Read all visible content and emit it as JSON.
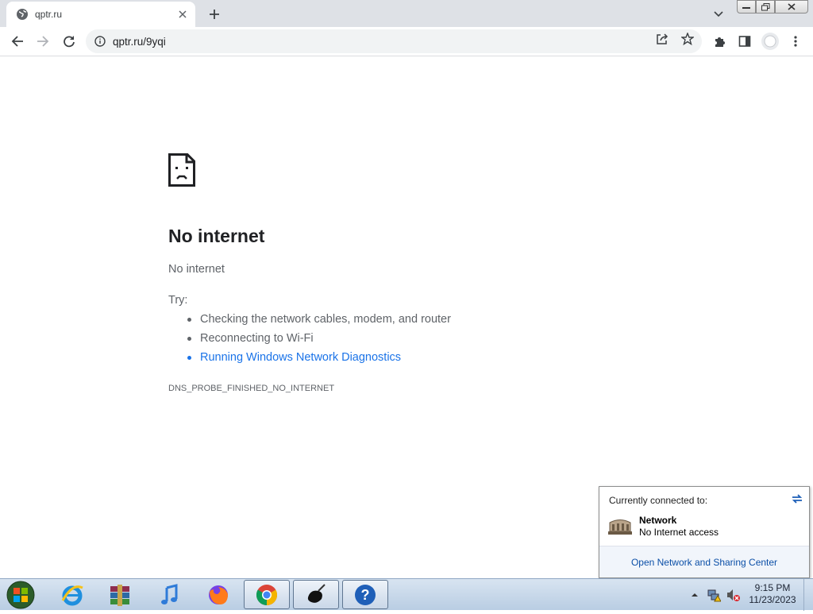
{
  "browser": {
    "tab": {
      "title": "qptr.ru",
      "favicon": "globe-icon"
    },
    "url": "qptr.ru/9yqi"
  },
  "error": {
    "heading": "No internet",
    "subheading": "No internet",
    "try_label": "Try:",
    "suggestions": [
      "Checking the network cables, modem, and router",
      "Reconnecting to Wi-Fi",
      "Running Windows Network Diagnostics"
    ],
    "code": "DNS_PROBE_FINISHED_NO_INTERNET"
  },
  "network_flyout": {
    "header": "Currently connected to:",
    "network_name": "Network",
    "network_status": "No Internet access",
    "footer_link": "Open Network and Sharing Center"
  },
  "taskbar": {
    "apps": [
      "internet-explorer-icon",
      "winrar-icon",
      "itunes-icon",
      "firefox-icon",
      "chrome-icon",
      "ink-icon",
      "help-icon"
    ],
    "clock_time": "9:15 PM",
    "clock_date": "11/23/2023"
  },
  "colors": {
    "link_blue": "#1a73e8",
    "text_gray": "#5f6368",
    "tabstrip_bg": "#dee1e6"
  }
}
